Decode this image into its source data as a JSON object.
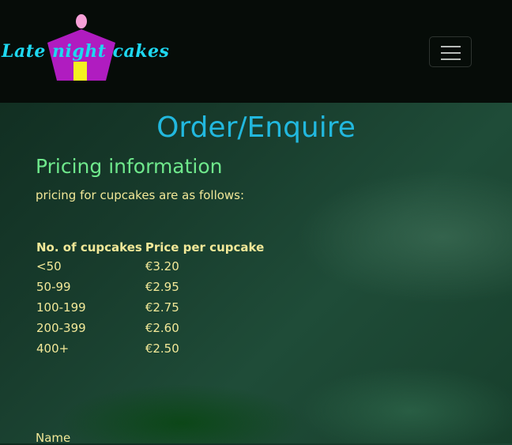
{
  "header": {
    "logo_text": "Late night cakes",
    "menu_toggle_label": "Toggle navigation"
  },
  "main": {
    "title": "Order/Enquire",
    "section_title": "Pricing information",
    "intro": "pricing for cupcakes are as follows:",
    "table": {
      "headers": [
        "No. of cupcakes",
        "Price per cupcake"
      ],
      "rows": [
        [
          "<50",
          "€3.20"
        ],
        [
          "50-99",
          "€2.95"
        ],
        [
          "100-199",
          "€2.75"
        ],
        [
          "200-399",
          "€2.60"
        ],
        [
          "400+",
          "€2.50"
        ]
      ]
    },
    "form": {
      "name_label": "Name"
    }
  },
  "colors": {
    "navbar": "#060c08",
    "title": "#22b8de",
    "section_title": "#6fe88c",
    "body_text": "#f2e898",
    "logo_text": "#1ed8f0",
    "logo_cupcake": "#b01cc0",
    "logo_topping": "#f7a0d8",
    "logo_window": "#f4f020"
  },
  "icons": {
    "logo": "cupcake-logo-icon",
    "menu": "hamburger-menu-icon"
  }
}
